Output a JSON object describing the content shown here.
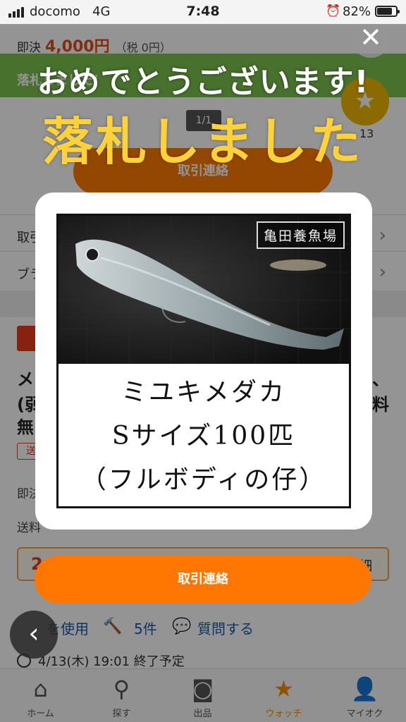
{
  "status_bar": {
    "carrier": "docomo",
    "network": "4G",
    "time": "7:48",
    "battery": "82%"
  },
  "background": {
    "price_label": "即決",
    "price": "4,000円",
    "tax": "（税 0円）",
    "banner_text": "落札しました！",
    "image_counter": "1/1",
    "side_number": "13",
    "contact_label": "取引連絡",
    "row1_label": "取引",
    "row2_label": "ブラ",
    "title_fragments": [
      "メ",
      "(弱",
      "無",
      "、",
      "料"
    ],
    "shipping_chip": "送",
    "instant_label": "即決",
    "shipping_label": "送料",
    "bid_left": "2",
    "bid_right": "細",
    "meta_use": "を使用",
    "meta_bids": "5件",
    "meta_question": "質問する",
    "end_time": "4/13(木) 19:01 終了予定"
  },
  "tabs": [
    {
      "label": "ホーム",
      "icon": "home-icon"
    },
    {
      "label": "探す",
      "icon": "search-icon"
    },
    {
      "label": "出品",
      "icon": "camera-icon"
    },
    {
      "label": "ウォッチ",
      "icon": "star-icon"
    },
    {
      "label": "マイオク",
      "icon": "user-icon"
    }
  ],
  "modal": {
    "close_symbol": "✕",
    "congrats": "おめでとうございます!",
    "won": "落札しました",
    "image_watermark": "亀田養魚場",
    "caption_lines": [
      "ミユキメダカ",
      "Sサイズ100匹",
      "（フルボディの仔）"
    ],
    "contact_button": "取引連絡",
    "back_symbol": "‹"
  }
}
